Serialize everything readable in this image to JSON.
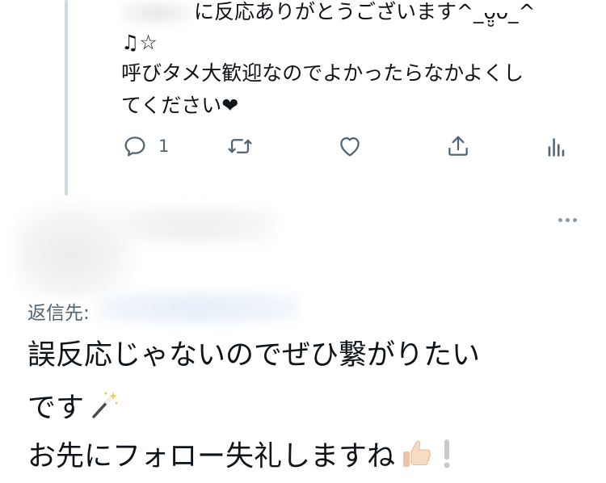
{
  "tweet1": {
    "lines": [
      "に反応ありがとうございます^_ᴗ̤̮ᴗ_^",
      "♫☆",
      "呼びタメ大歓迎なのでよかったらなかよくし",
      "てください❤"
    ],
    "actions": {
      "reply_count": "1",
      "reply_icon": "reply-icon",
      "retweet_icon": "retweet-icon",
      "like_icon": "heart-icon",
      "share_icon": "share-icon",
      "analytics_icon": "analytics-icon"
    }
  },
  "tweet2": {
    "reply_label": "返信先:",
    "lines": [
      "誤反応じゃないのでぜひ繋がりたい",
      "です",
      "お先にフォロー失礼しますね"
    ],
    "emojis": [
      "magic-wand-emoji",
      "thumbs-up-emoji",
      "exclamation-emoji"
    ]
  },
  "colors": {
    "text": "#0f1419",
    "secondary": "#536471",
    "thread_line": "#cfd9de"
  }
}
